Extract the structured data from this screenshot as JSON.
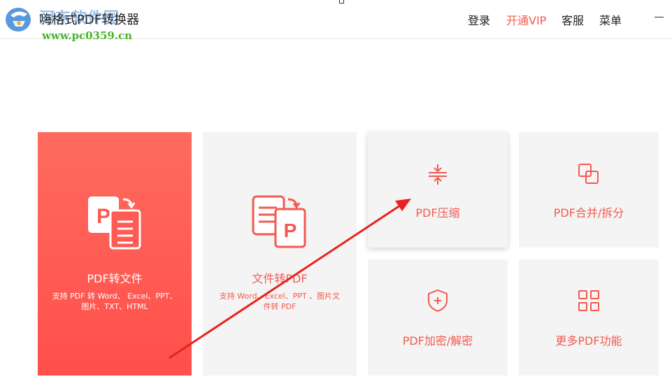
{
  "header": {
    "app_title": "嗨格式PDF转换器",
    "watermark_title": "河东软件园",
    "watermark_url": "www.pc0359.cn",
    "nav": {
      "login": "登录",
      "vip": "开通VIP",
      "service": "客服",
      "menu": "菜单"
    },
    "logo_icon": "app-logo-icon",
    "minimize_icon": "minimize-icon"
  },
  "cards": {
    "pdf_to_file": {
      "label": "PDF转文件",
      "desc": "支持 PDF 转 Word、 Excel、PPT、图片、TXT、HTML",
      "icon": "pdf-to-file-icon"
    },
    "file_to_pdf": {
      "label": "文件转PDF",
      "desc": "支持 Word、Excel、PPT 、图片文件转 PDF",
      "icon": "file-to-pdf-icon"
    },
    "compress": {
      "label": "PDF压缩",
      "icon": "compress-icon"
    },
    "merge_split": {
      "label": "PDF合并/拆分",
      "icon": "merge-icon"
    },
    "encrypt": {
      "label": "PDF加密/解密",
      "icon": "shield-icon"
    },
    "more": {
      "label": "更多PDF功能",
      "icon": "grid-icon"
    }
  },
  "colors": {
    "accent": "#f25a50",
    "card_bg": "#f4f4f4",
    "primary_gradient_top": "#ff6b5e",
    "primary_gradient_bottom": "#ff4f4b",
    "annotation_arrow": "#e8231e"
  }
}
